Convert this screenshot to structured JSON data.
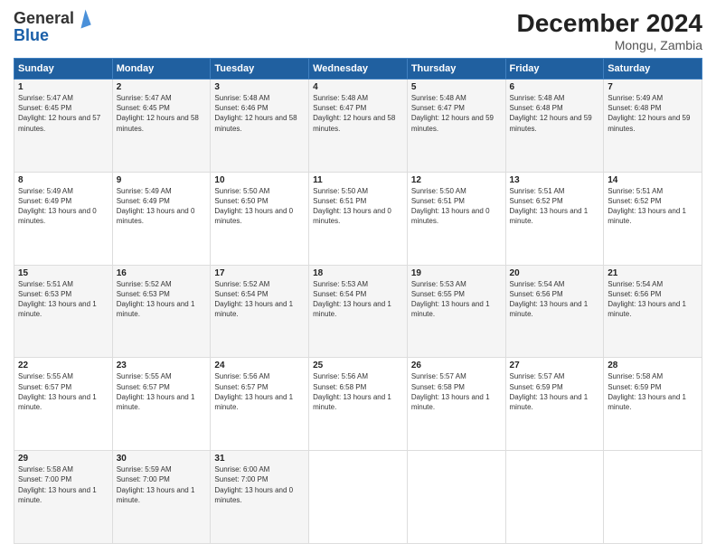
{
  "header": {
    "logo_text_general": "General",
    "logo_text_blue": "Blue",
    "month_title": "December 2024",
    "location": "Mongu, Zambia"
  },
  "days_of_week": [
    "Sunday",
    "Monday",
    "Tuesday",
    "Wednesday",
    "Thursday",
    "Friday",
    "Saturday"
  ],
  "weeks": [
    [
      {
        "day": "1",
        "sunrise": "5:47 AM",
        "sunset": "6:45 PM",
        "daylight": "12 hours and 57 minutes."
      },
      {
        "day": "2",
        "sunrise": "5:47 AM",
        "sunset": "6:45 PM",
        "daylight": "12 hours and 58 minutes."
      },
      {
        "day": "3",
        "sunrise": "5:48 AM",
        "sunset": "6:46 PM",
        "daylight": "12 hours and 58 minutes."
      },
      {
        "day": "4",
        "sunrise": "5:48 AM",
        "sunset": "6:47 PM",
        "daylight": "12 hours and 58 minutes."
      },
      {
        "day": "5",
        "sunrise": "5:48 AM",
        "sunset": "6:47 PM",
        "daylight": "12 hours and 59 minutes."
      },
      {
        "day": "6",
        "sunrise": "5:48 AM",
        "sunset": "6:48 PM",
        "daylight": "12 hours and 59 minutes."
      },
      {
        "day": "7",
        "sunrise": "5:49 AM",
        "sunset": "6:48 PM",
        "daylight": "12 hours and 59 minutes."
      }
    ],
    [
      {
        "day": "8",
        "sunrise": "5:49 AM",
        "sunset": "6:49 PM",
        "daylight": "13 hours and 0 minutes."
      },
      {
        "day": "9",
        "sunrise": "5:49 AM",
        "sunset": "6:49 PM",
        "daylight": "13 hours and 0 minutes."
      },
      {
        "day": "10",
        "sunrise": "5:50 AM",
        "sunset": "6:50 PM",
        "daylight": "13 hours and 0 minutes."
      },
      {
        "day": "11",
        "sunrise": "5:50 AM",
        "sunset": "6:51 PM",
        "daylight": "13 hours and 0 minutes."
      },
      {
        "day": "12",
        "sunrise": "5:50 AM",
        "sunset": "6:51 PM",
        "daylight": "13 hours and 0 minutes."
      },
      {
        "day": "13",
        "sunrise": "5:51 AM",
        "sunset": "6:52 PM",
        "daylight": "13 hours and 1 minute."
      },
      {
        "day": "14",
        "sunrise": "5:51 AM",
        "sunset": "6:52 PM",
        "daylight": "13 hours and 1 minute."
      }
    ],
    [
      {
        "day": "15",
        "sunrise": "5:51 AM",
        "sunset": "6:53 PM",
        "daylight": "13 hours and 1 minute."
      },
      {
        "day": "16",
        "sunrise": "5:52 AM",
        "sunset": "6:53 PM",
        "daylight": "13 hours and 1 minute."
      },
      {
        "day": "17",
        "sunrise": "5:52 AM",
        "sunset": "6:54 PM",
        "daylight": "13 hours and 1 minute."
      },
      {
        "day": "18",
        "sunrise": "5:53 AM",
        "sunset": "6:54 PM",
        "daylight": "13 hours and 1 minute."
      },
      {
        "day": "19",
        "sunrise": "5:53 AM",
        "sunset": "6:55 PM",
        "daylight": "13 hours and 1 minute."
      },
      {
        "day": "20",
        "sunrise": "5:54 AM",
        "sunset": "6:56 PM",
        "daylight": "13 hours and 1 minute."
      },
      {
        "day": "21",
        "sunrise": "5:54 AM",
        "sunset": "6:56 PM",
        "daylight": "13 hours and 1 minute."
      }
    ],
    [
      {
        "day": "22",
        "sunrise": "5:55 AM",
        "sunset": "6:57 PM",
        "daylight": "13 hours and 1 minute."
      },
      {
        "day": "23",
        "sunrise": "5:55 AM",
        "sunset": "6:57 PM",
        "daylight": "13 hours and 1 minute."
      },
      {
        "day": "24",
        "sunrise": "5:56 AM",
        "sunset": "6:57 PM",
        "daylight": "13 hours and 1 minute."
      },
      {
        "day": "25",
        "sunrise": "5:56 AM",
        "sunset": "6:58 PM",
        "daylight": "13 hours and 1 minute."
      },
      {
        "day": "26",
        "sunrise": "5:57 AM",
        "sunset": "6:58 PM",
        "daylight": "13 hours and 1 minute."
      },
      {
        "day": "27",
        "sunrise": "5:57 AM",
        "sunset": "6:59 PM",
        "daylight": "13 hours and 1 minute."
      },
      {
        "day": "28",
        "sunrise": "5:58 AM",
        "sunset": "6:59 PM",
        "daylight": "13 hours and 1 minute."
      }
    ],
    [
      {
        "day": "29",
        "sunrise": "5:58 AM",
        "sunset": "7:00 PM",
        "daylight": "13 hours and 1 minute."
      },
      {
        "day": "30",
        "sunrise": "5:59 AM",
        "sunset": "7:00 PM",
        "daylight": "13 hours and 1 minute."
      },
      {
        "day": "31",
        "sunrise": "6:00 AM",
        "sunset": "7:00 PM",
        "daylight": "13 hours and 0 minutes."
      },
      null,
      null,
      null,
      null
    ]
  ],
  "labels": {
    "sunrise_prefix": "Sunrise: ",
    "sunset_prefix": "Sunset: ",
    "daylight_prefix": "Daylight: "
  }
}
